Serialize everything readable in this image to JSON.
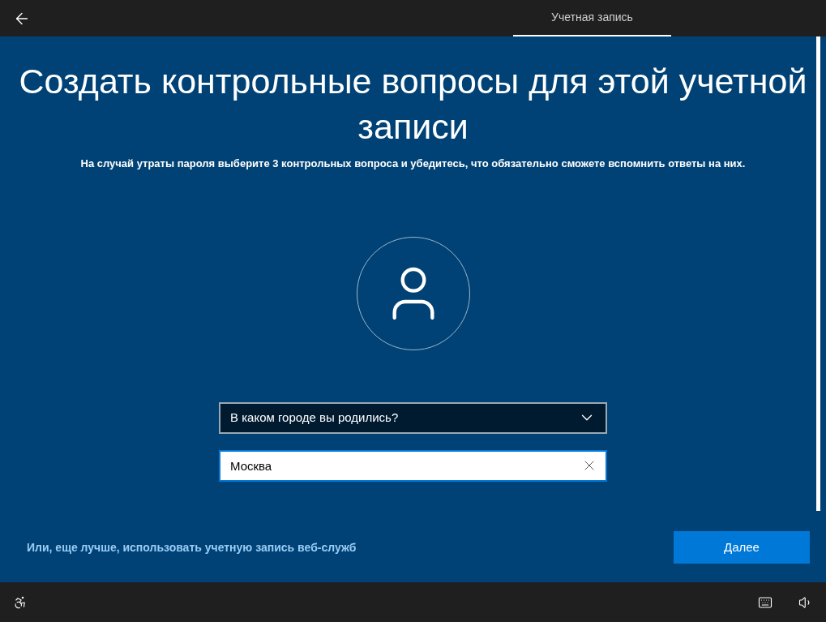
{
  "tabs": [
    {
      "label": "Учетная запись",
      "selected": true
    }
  ],
  "title": "Создать контрольные вопросы для этой учетной записи",
  "subtitle": "На случай утраты пароля выберите 3 контрольных вопроса и убедитесь, что обязательно сможете вспомнить ответы на них.",
  "question_dropdown": {
    "value": "В каком городе вы родились?"
  },
  "answer_field": {
    "value": "Москва"
  },
  "link": "Или, еще лучше, использовать учетную запись веб-служб",
  "next_button": "Далее"
}
